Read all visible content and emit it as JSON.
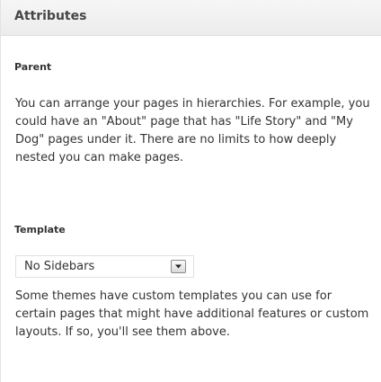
{
  "panel": {
    "title": "Attributes"
  },
  "parent": {
    "label": "Parent",
    "help": "You can arrange your pages in hierarchies. For example, you could have an \"About\" page that has \"Life Story\" and \"My Dog\" pages under it. There are no limits to how deeply nested you can make pages."
  },
  "template": {
    "label": "Template",
    "selected": "No Sidebars",
    "help": "Some themes have custom templates you can use for certain pages that might have additional features or custom layouts. If so, you'll see them above."
  },
  "icons": {
    "dropdown": "chevron-down-icon"
  }
}
